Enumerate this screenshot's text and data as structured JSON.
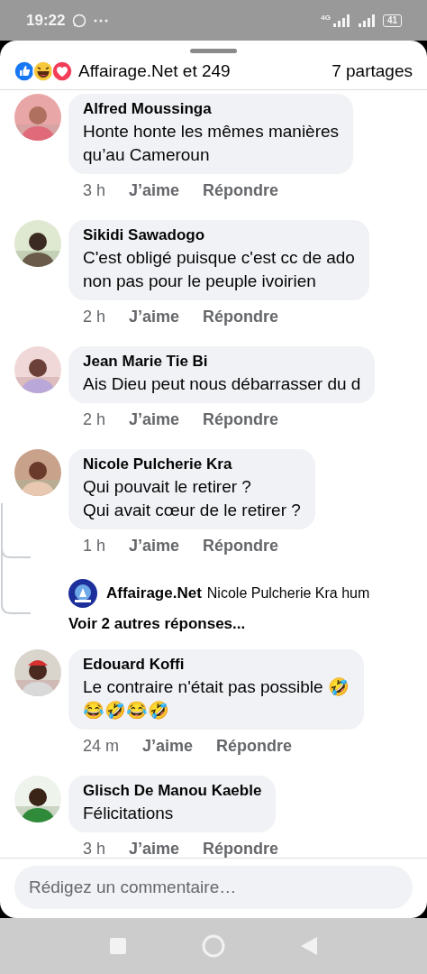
{
  "status_bar": {
    "time": "19:22",
    "network": "4G",
    "battery": "41"
  },
  "reactions": {
    "summary": "Affairage.Net et 249",
    "shares": "7 partages"
  },
  "comments": [
    {
      "author": "Alfred Moussinga",
      "text": "Honte honte les mêmes manières\nqu’au Cameroun",
      "time": "3 h",
      "like": "J’aime",
      "reply": "Répondre"
    },
    {
      "author": "Sikidi Sawadogo",
      "text": "C'est obligé puisque c'est cc de ado\nnon pas pour le peuple ivoirien",
      "time": "2 h",
      "like": "J’aime",
      "reply": "Répondre"
    },
    {
      "author": "Jean Marie Tie Bi",
      "text": "Ais Dieu peut nous débarrasser du d",
      "time": "2 h",
      "like": "J’aime",
      "reply": "Répondre"
    },
    {
      "author": "Nicole Pulcherie Kra",
      "text": "Qui pouvait le retirer ?\nQui avait cœur de le retirer ?",
      "time": "1 h",
      "like": "J’aime",
      "reply": "Répondre",
      "replies": [
        {
          "author": "Affairage.Net",
          "text": "Nicole Pulcherie Kra hum"
        }
      ],
      "more_replies": "Voir 2 autres réponses..."
    },
    {
      "author": "Edouard Koffi",
      "text": "Le contraire n'était pas possible 🤣\n😂🤣😂🤣",
      "time": "24 m",
      "like": "J’aime",
      "reply": "Répondre"
    },
    {
      "author": "Glisch De Manou Kaeble",
      "text": "Félicitations",
      "time": "3 h",
      "like": "J’aime",
      "reply": "Répondre"
    }
  ],
  "composer": {
    "placeholder": "Rédigez un commentaire…"
  }
}
